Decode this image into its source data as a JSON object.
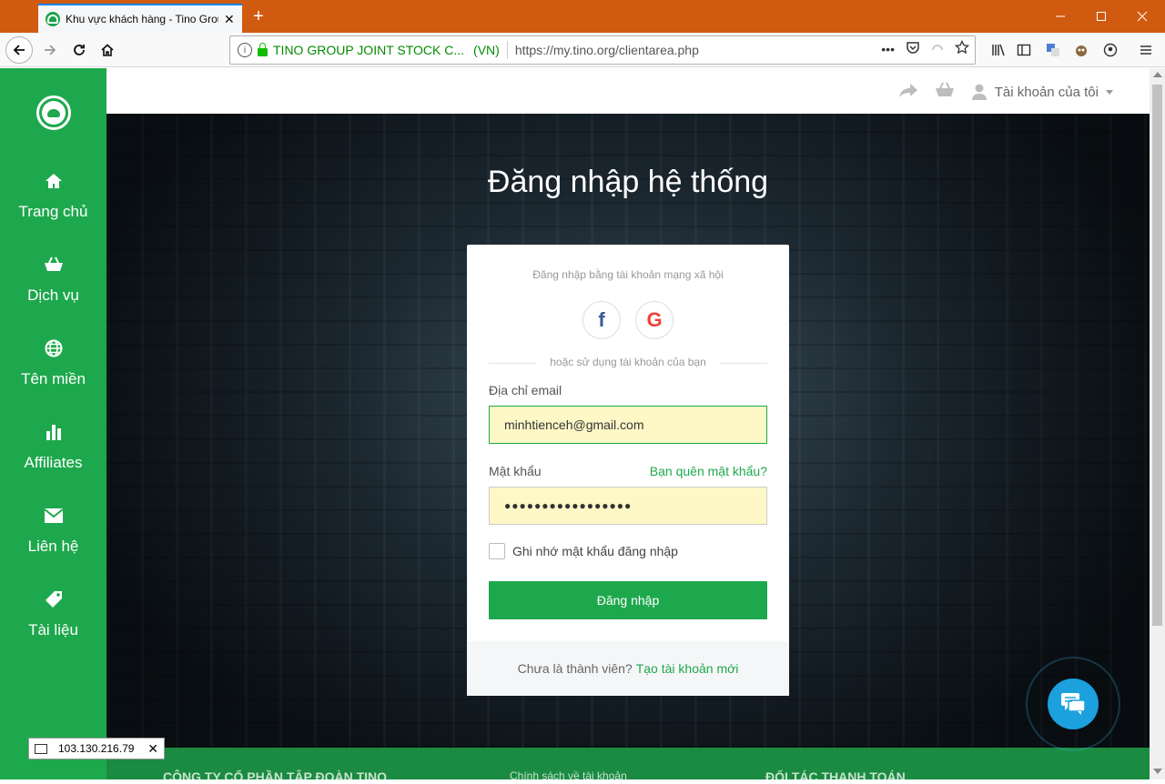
{
  "browser": {
    "tab_title": "Khu vực khách hàng - Tino Group",
    "tab_close": "✕",
    "new_tab": "+",
    "url_identity": "TINO GROUP JOINT STOCK C...",
    "url_country": "(VN)",
    "url": "https://my.tino.org/clientarea.php",
    "url_more": "•••"
  },
  "sidebar": {
    "items": [
      {
        "label": "Trang chủ",
        "icon": "home-icon"
      },
      {
        "label": "Dịch vụ",
        "icon": "basket-icon"
      },
      {
        "label": "Tên miền",
        "icon": "globe-icon"
      },
      {
        "label": "Affiliates",
        "icon": "bar-chart-icon"
      },
      {
        "label": "Liên hệ",
        "icon": "envelope-icon"
      },
      {
        "label": "Tài liệu",
        "icon": "tag-icon"
      }
    ]
  },
  "topbar": {
    "account_label": "Tài khoản của tôi"
  },
  "login": {
    "title": "Đăng nhập hệ thống",
    "social_title": "Đăng nhập bằng tài khoản mạng xã hội",
    "facebook_glyph": "f",
    "google_glyph": "G",
    "divider_text": "hoặc sử dụng tài khoản của bạn",
    "email_label": "Địa chỉ email",
    "email_value": "minhtienceh@gmail.com",
    "password_label": "Mật khẩu",
    "password_value": "●●●●●●●●●●●●●●●●●",
    "forgot_label": "Bạn quên mật khẩu?",
    "remember_label": "Ghi nhớ mật khẩu đăng nhập",
    "submit_label": "Đăng nhập",
    "not_member": "Chưa là thành viên?",
    "register_link": "Tạo tài khoản mới"
  },
  "footer": {
    "company": "CÔNG TY CỔ PHẦN TẬP ĐOÀN TINO",
    "policy": "Chính sách về tài khoản",
    "partners": "ĐỐI TÁC THANH TOÁN"
  },
  "ip_badge": {
    "ip": "103.130.216.79",
    "close": "✕"
  },
  "colors": {
    "brand_green": "#1ea84d",
    "chat_blue": "#1ca0de",
    "tab_bar": "#d05a10"
  }
}
